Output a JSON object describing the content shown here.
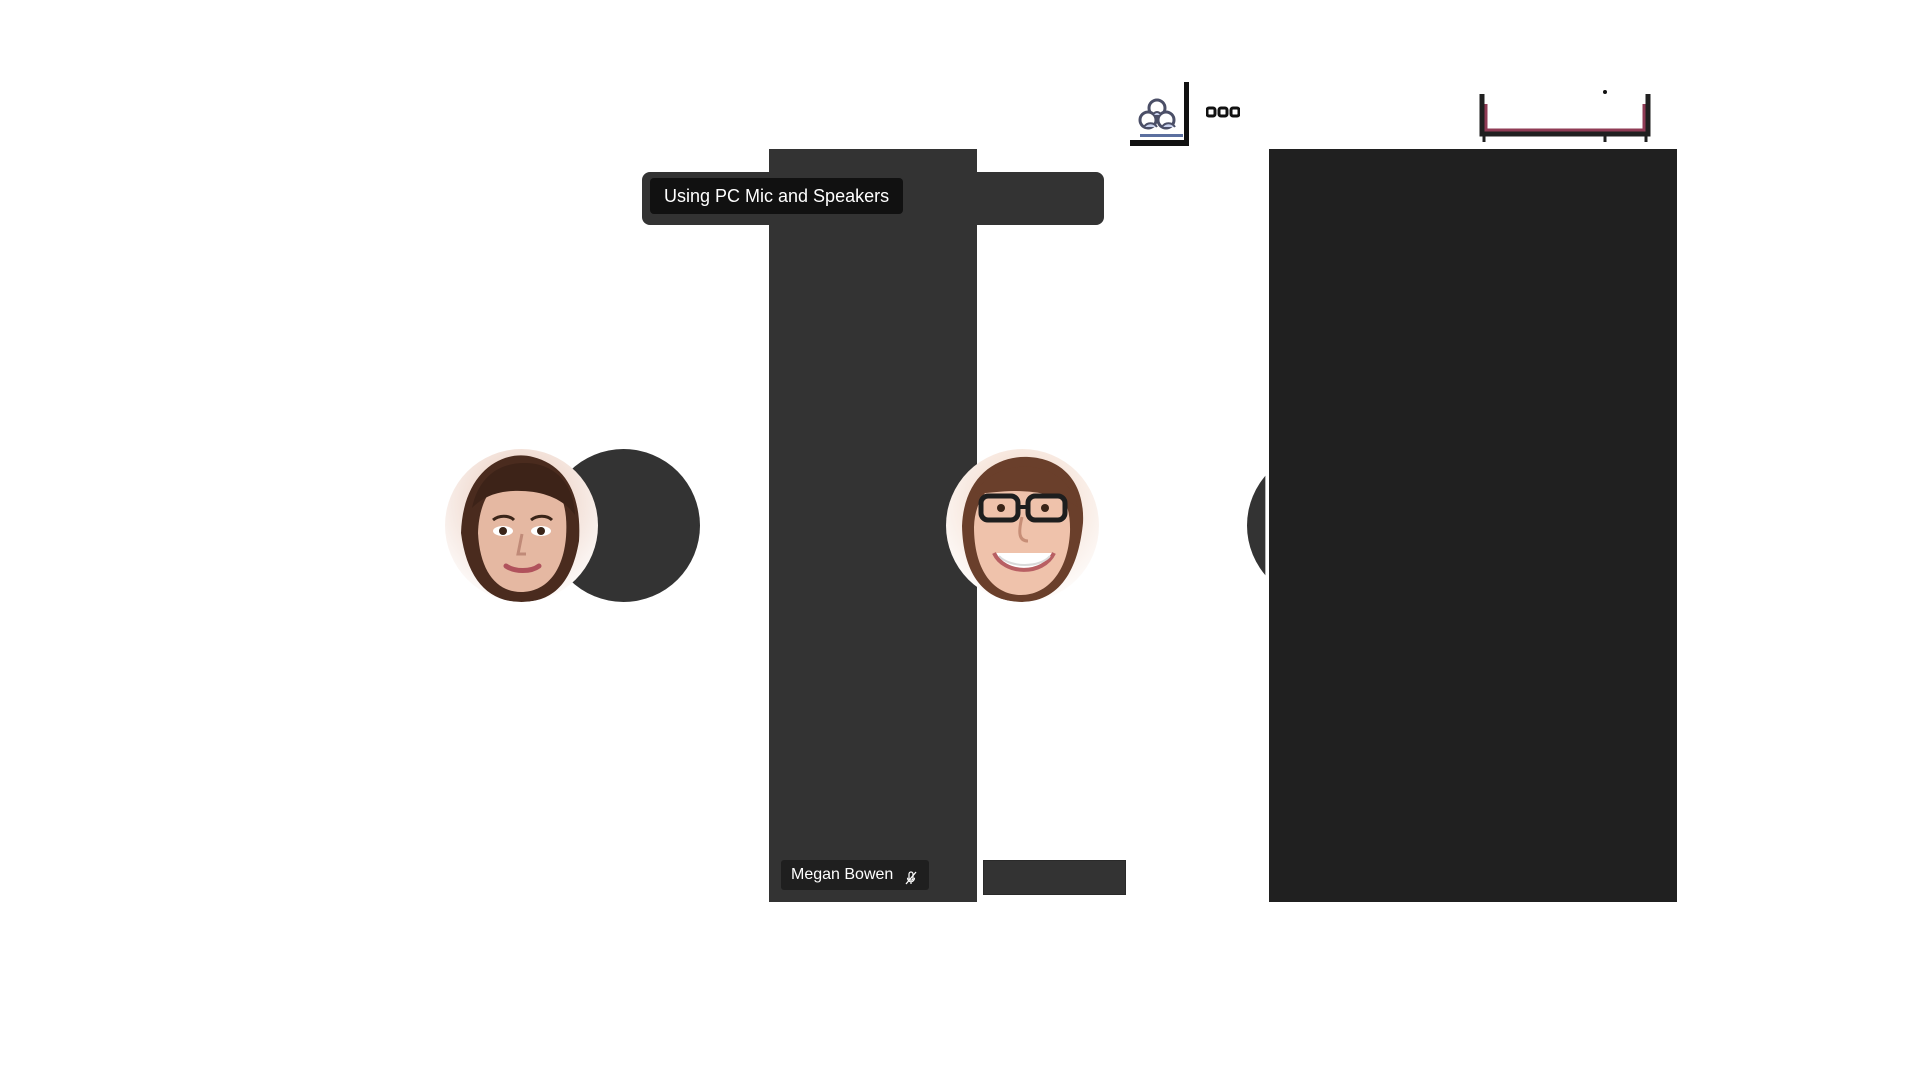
{
  "window": {
    "background": "#ffffff"
  },
  "audio_notice": {
    "label": "Using PC Mic and Speakers"
  },
  "participants": [
    {
      "name": "Megan Bowen",
      "avatar_icon": "female-avatar",
      "muted_icon": "mic-off-icon"
    },
    {
      "name": "",
      "avatar_icon": "smiling-avatar"
    }
  ],
  "toolbar": {
    "participants_icon": "people-icon",
    "more_icon": "more-options-icon",
    "bracket_icon": "window-frame-icon"
  },
  "colors": {
    "tile_dark": "#333333",
    "tile_darker": "#202020",
    "chip_dark": "#1f1f1f",
    "tooltip_dark": "#111111",
    "accent_red": "#8f3b55"
  }
}
